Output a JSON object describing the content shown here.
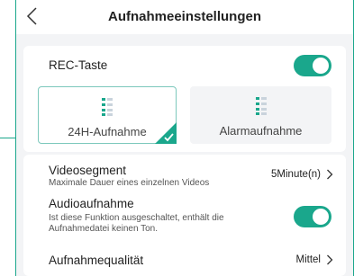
{
  "header": {
    "title": "Aufnahmeeinstellungen"
  },
  "rec_button": {
    "label": "REC-Taste",
    "enabled": true
  },
  "modes": [
    {
      "label": "24H-Aufnahme",
      "selected": true
    },
    {
      "label": "Alarmaufnahme",
      "selected": false
    }
  ],
  "settings": {
    "video_segment": {
      "label": "Videosegment",
      "description": "Maximale Dauer eines einzelnen Videos",
      "value": "5Minute(n)"
    },
    "audio": {
      "label": "Audioaufnahme",
      "description_line1": "Ist diese Funktion ausgeschaltet, enthält die",
      "description_line2": "Aufnahmedatei keinen Ton.",
      "enabled": true
    },
    "quality": {
      "label": "Aufnahmequalität",
      "value": "Mittel"
    }
  },
  "colors": {
    "accent": "#1aa78c",
    "background": "#f3f4f6"
  }
}
